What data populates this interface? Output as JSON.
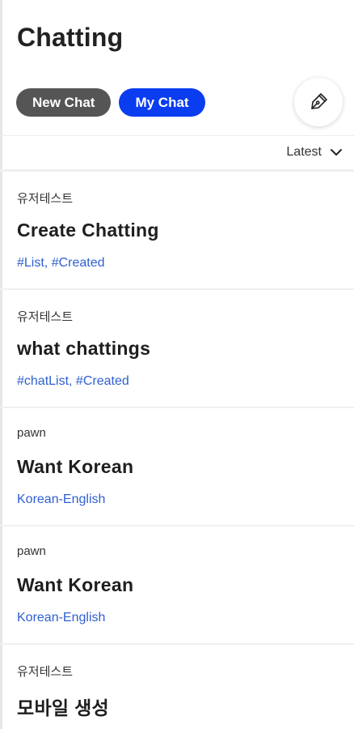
{
  "header": {
    "title": "Chatting",
    "new_chat_label": "New Chat",
    "my_chat_label": "My Chat",
    "write_icon": "pen-nib-icon"
  },
  "sort": {
    "label": "Latest",
    "icon": "chevron-down-icon"
  },
  "colors": {
    "new_chat_bg": "#555555",
    "my_chat_bg": "#0a3cf0",
    "tag_color": "#2f5fd0"
  },
  "chats": [
    {
      "author": "유저테스트",
      "title": "Create Chatting",
      "tags": "#List, #Created"
    },
    {
      "author": "유저테스트",
      "title": "what chattings",
      "tags": "#chatList, #Created"
    },
    {
      "author": "pawn",
      "title": "Want Korean",
      "tags": "Korean-English"
    },
    {
      "author": "pawn",
      "title": "Want Korean",
      "tags": "Korean-English"
    },
    {
      "author": "유저테스트",
      "title": "모바일 생성",
      "tags": ""
    }
  ]
}
